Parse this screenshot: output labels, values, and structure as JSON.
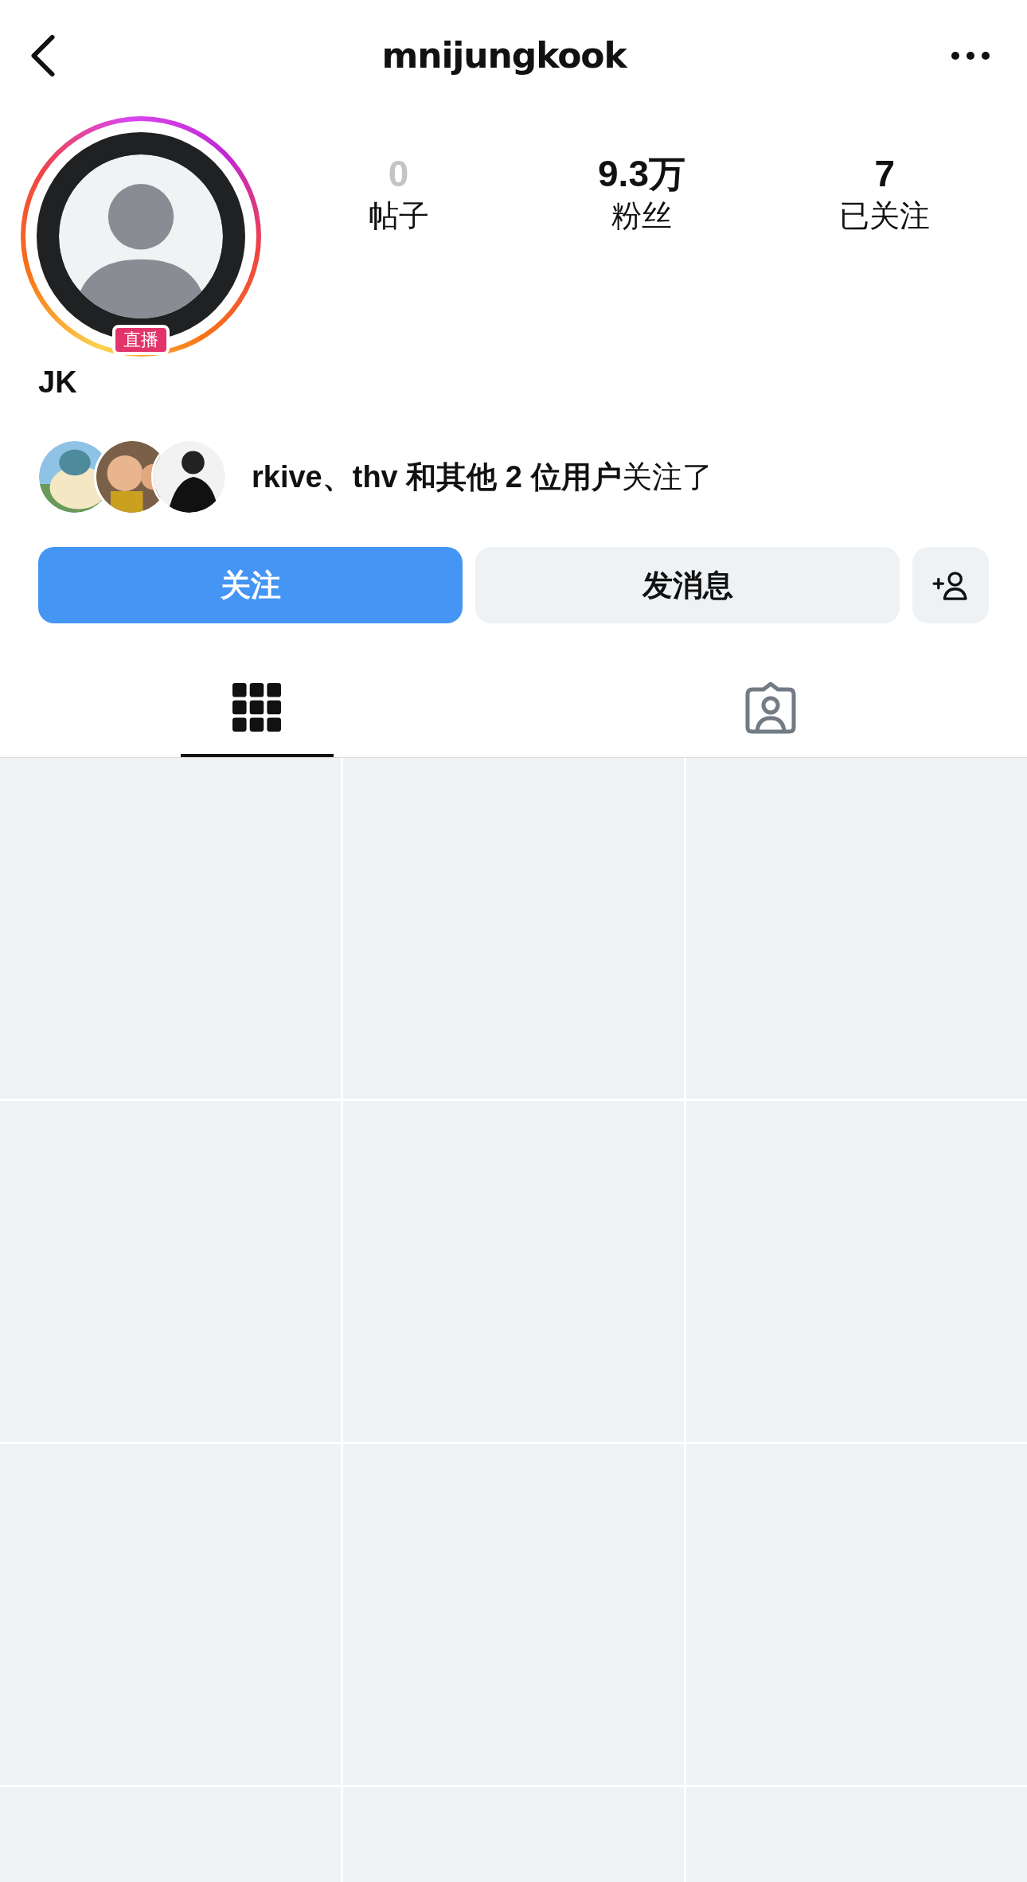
{
  "header": {
    "title": "mnijungkook"
  },
  "profile": {
    "live": true,
    "live_badge": "直播",
    "name": "JK"
  },
  "stats": [
    {
      "value": "0",
      "label": "帖子",
      "disabled": true
    },
    {
      "value": "9.3万",
      "label": "粉丝",
      "disabled": false
    },
    {
      "value": "7",
      "label": "已关注",
      "disabled": false
    }
  ],
  "mutual_followers": {
    "text": "**rkive、thv 和其他 2 位用户**关注了"
  },
  "buttons": [
    {
      "label": "关注",
      "kind": "primary"
    },
    {
      "label": "发消息",
      "kind": "secondary"
    },
    {
      "kind": "add-person"
    }
  ],
  "tabs": [
    {
      "kind": "grid",
      "selected": true
    },
    {
      "kind": "tagged",
      "selected": false
    }
  ],
  "posts": [
    {
      "kind": "placeholder"
    },
    {
      "kind": "placeholder"
    },
    {
      "kind": "placeholder"
    },
    {
      "kind": "placeholder"
    },
    {
      "kind": "placeholder"
    },
    {
      "kind": "placeholder"
    },
    {
      "kind": "placeholder"
    },
    {
      "kind": "placeholder"
    },
    {
      "kind": "placeholder"
    },
    {
      "kind": "placeholder"
    },
    {
      "kind": "placeholder"
    },
    {
      "kind": "placeholder"
    }
  ]
}
